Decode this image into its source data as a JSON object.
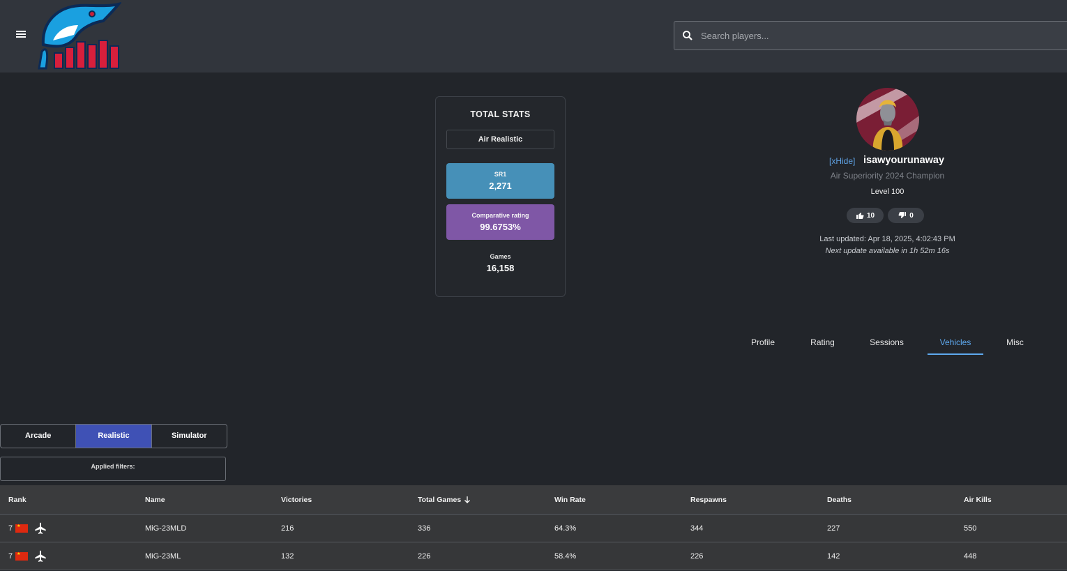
{
  "header": {
    "search_placeholder": "Search players..."
  },
  "stats": {
    "title": "TOTAL STATS",
    "mode": "Air Realistic",
    "sr_label": "SR1",
    "sr_value": "2,271",
    "comparative_label": "Comparative rating",
    "comparative_value": "99.6753%",
    "games_label": "Games",
    "games_value": "16,158"
  },
  "profile": {
    "clan_tag": "[xHide]",
    "username": "isawyourunaway",
    "title": "Air Superiority 2024 Champion",
    "level": "Level 100",
    "likes": "10",
    "dislikes": "0",
    "last_updated": "Last updated: Apr 18, 2025, 4:02:43 PM",
    "next_update": "Next update available in 1h 52m 16s"
  },
  "tabs": [
    {
      "label": "Profile"
    },
    {
      "label": "Rating"
    },
    {
      "label": "Sessions"
    },
    {
      "label": "Vehicles"
    },
    {
      "label": "Misc"
    }
  ],
  "active_tab": "Vehicles",
  "modes": [
    {
      "label": "Arcade"
    },
    {
      "label": "Realistic"
    },
    {
      "label": "Simulator"
    }
  ],
  "active_mode": "Realistic",
  "filters_label": "Applied filters:",
  "table": {
    "columns": [
      "Rank",
      "Name",
      "Victories",
      "Total Games",
      "Win Rate",
      "Respawns",
      "Deaths",
      "Air Kills"
    ],
    "sorted_column": "Total Games",
    "rows": [
      {
        "rank": "7",
        "name": "MiG-23MLD",
        "victories": "216",
        "total_games": "336",
        "win_rate": "64.3%",
        "respawns": "344",
        "deaths": "227",
        "air_kills": "550"
      },
      {
        "rank": "7",
        "name": "MiG-23ML",
        "victories": "132",
        "total_games": "226",
        "win_rate": "58.4%",
        "respawns": "226",
        "deaths": "142",
        "air_kills": "448"
      }
    ]
  },
  "colors": {
    "accent_blue": "#5ea9ef",
    "sr_box": "#4690b8",
    "comparative_box": "#7f57a6",
    "active_mode": "#3f51b5"
  }
}
